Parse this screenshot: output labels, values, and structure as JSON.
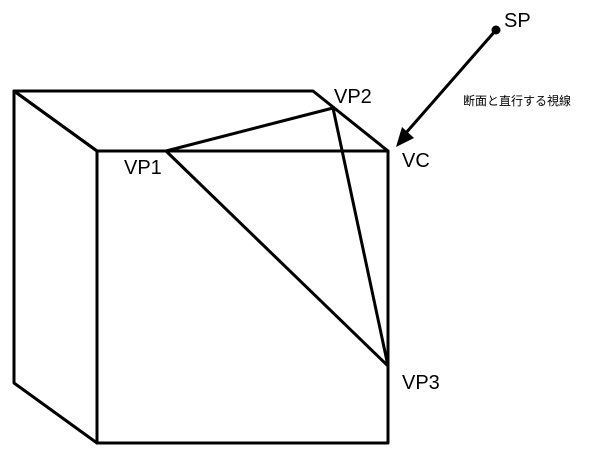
{
  "labels": {
    "sp": "SP",
    "vp1": "VP1",
    "vp2": "VP2",
    "vp3": "VP3",
    "vc": "VC"
  },
  "caption": "断面と直行する視線",
  "colors": {
    "line": "#000000",
    "background": "#ffffff"
  }
}
